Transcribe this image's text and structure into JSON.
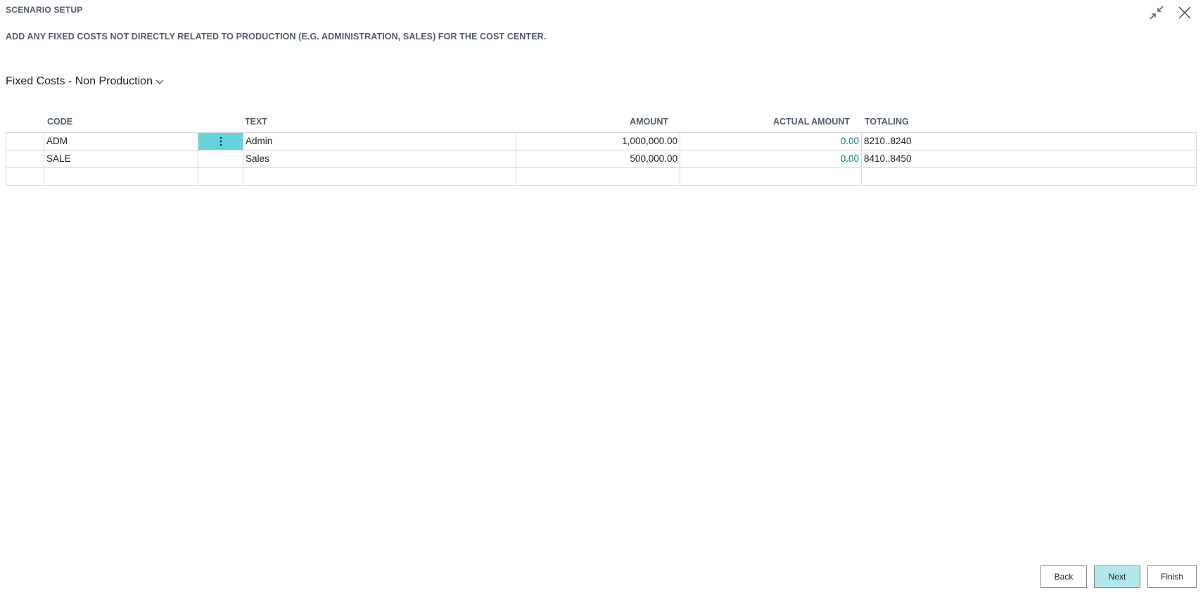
{
  "window": {
    "title": "SCENARIO SETUP"
  },
  "instruction": "ADD ANY FIXED COSTS NOT DIRECTLY RELATED TO PRODUCTION (E.G. ADMINISTRATION, SALES) FOR THE COST CENTER.",
  "section": {
    "title": "Fixed Costs - Non Production"
  },
  "table": {
    "headers": {
      "code": "CODE",
      "text": "TEXT",
      "amount": "AMOUNT",
      "actual_amount": "ACTUAL AMOUNT",
      "totaling": "TOTALING"
    },
    "rows": [
      {
        "code": "ADM",
        "text": "Admin",
        "amount": "1,000,000.00",
        "actual_amount": "0.00",
        "totaling": "8210..8240"
      },
      {
        "code": "SALE",
        "text": "Sales",
        "amount": "500,000.00",
        "actual_amount": "0.00",
        "totaling": "8410..8450"
      },
      {
        "code": "",
        "text": "",
        "amount": "",
        "actual_amount": "",
        "totaling": ""
      }
    ]
  },
  "buttons": {
    "back": "Back",
    "next": "Next",
    "finish": "Finish"
  },
  "colors": {
    "accent": "#62d4dc",
    "primary_button": "#b2e8ec",
    "link": "#007e8a"
  },
  "icons": {
    "collapse": "collapse-icon",
    "close": "close-icon",
    "dropdown": "chevron-down-icon",
    "row_menu": "more-vertical-icon"
  }
}
